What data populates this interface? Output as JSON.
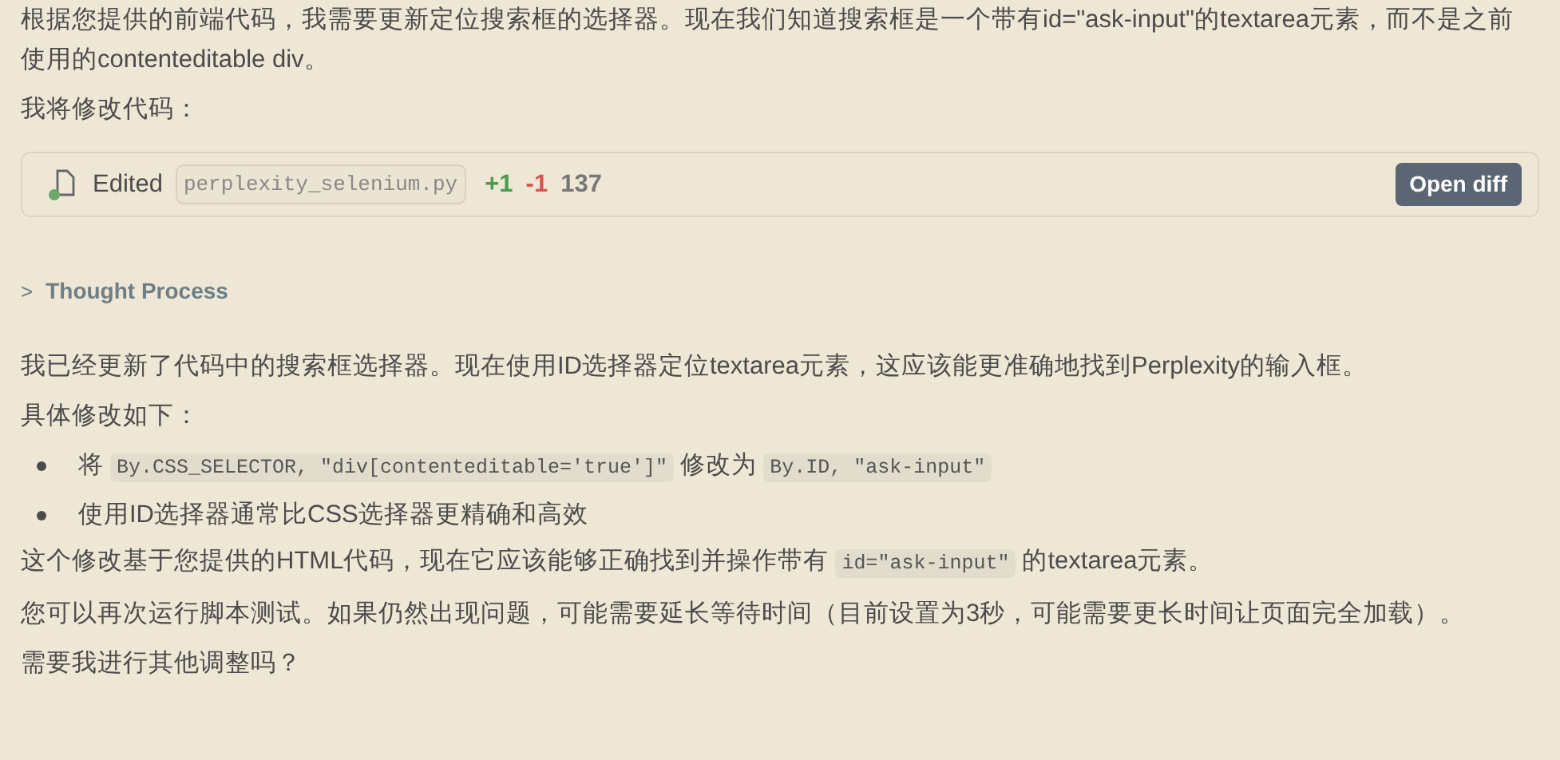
{
  "intro": [
    "根据您提供的前端代码，我需要更新定位搜索框的选择器。现在我们知道搜索框是一个带有id=\"ask-input\"的textarea元素，而不是之前使用的contenteditable div。",
    "我将修改代码："
  ],
  "edit_card": {
    "label": "Edited",
    "file": "perplexity_selenium.py",
    "added": "+1",
    "removed": "-1",
    "lines": "137",
    "button": "Open diff"
  },
  "thought": {
    "toggle": ">",
    "label": "Thought Process",
    "expanded": false
  },
  "blocks": [
    {
      "kind": "para",
      "segments": [
        {
          "kind": "text",
          "text": "我已经更新了代码中的搜索框选择器。现在使用ID选择器定位textarea元素，这应该能更准确地找到Perplexity的输入框。"
        }
      ]
    },
    {
      "kind": "para",
      "segments": [
        {
          "kind": "text",
          "text": "具体修改如下："
        }
      ]
    },
    {
      "kind": "bullet",
      "segments": [
        {
          "kind": "text",
          "text": "将"
        },
        {
          "kind": "code",
          "text": "By.CSS_SELECTOR, \"div[contenteditable='true']\""
        },
        {
          "kind": "text",
          "text": "修改为"
        },
        {
          "kind": "code",
          "text": "By.ID, \"ask-input\""
        }
      ]
    },
    {
      "kind": "bullet",
      "segments": [
        {
          "kind": "text",
          "text": "使用ID选择器通常比CSS选择器更精确和高效"
        }
      ]
    },
    {
      "kind": "para",
      "segments": [
        {
          "kind": "text",
          "text": "这个修改基于您提供的HTML代码，现在它应该能够正确找到并操作带有"
        },
        {
          "kind": "code",
          "text": "id=\"ask-input\""
        },
        {
          "kind": "text",
          "text": "的textarea元素。"
        }
      ]
    },
    {
      "kind": "para",
      "segments": [
        {
          "kind": "text",
          "text": "您可以再次运行脚本测试。如果仍然出现问题，可能需要延长等待时间（目前设置为3秒，可能需要更长时间让页面完全加载）。"
        }
      ]
    },
    {
      "kind": "para",
      "segments": [
        {
          "kind": "text",
          "text": "需要我进行其他调整吗？"
        }
      ]
    }
  ]
}
